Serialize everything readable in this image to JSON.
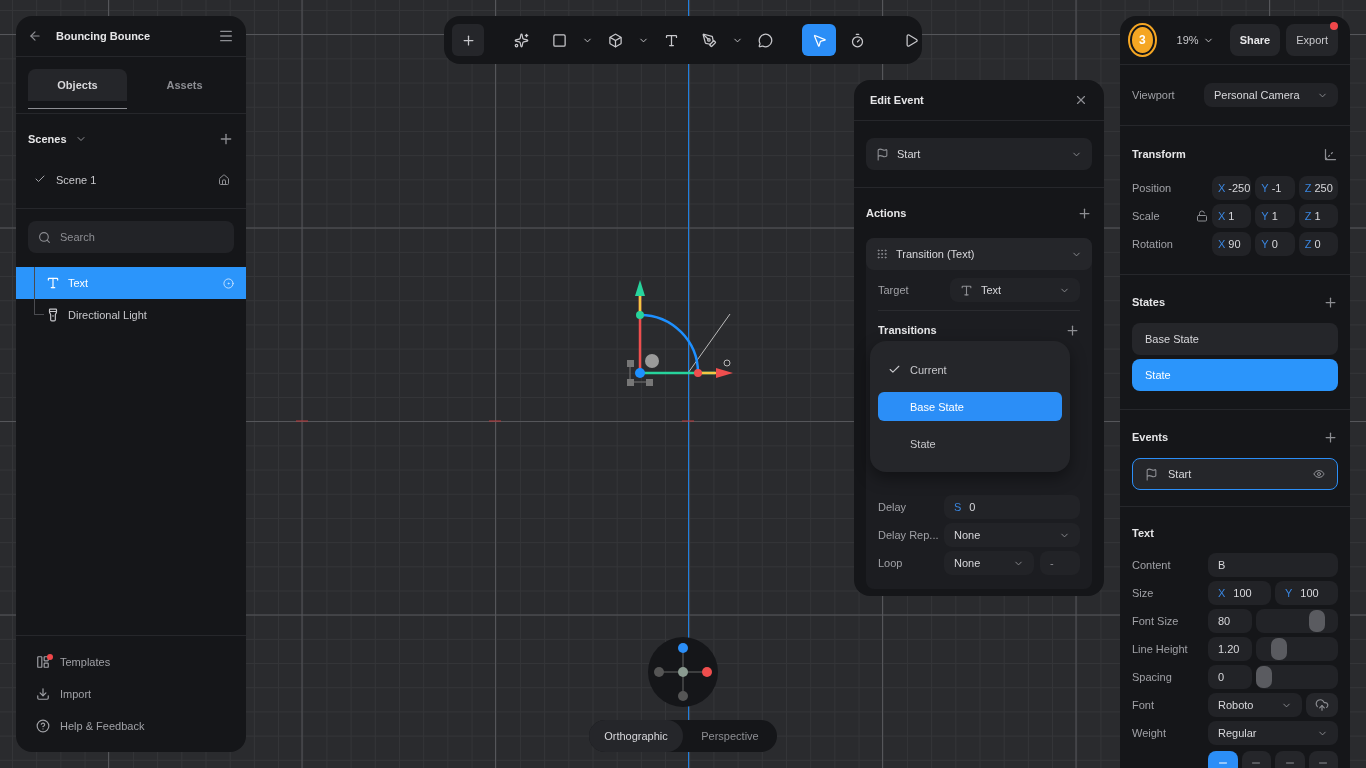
{
  "project": {
    "title": "Bouncing Bounce"
  },
  "left_tabs": [
    {
      "label": "Objects",
      "selected": true
    },
    {
      "label": "Assets",
      "selected": false
    }
  ],
  "scenes": {
    "title": "Scenes",
    "items": [
      {
        "label": "Scene 1",
        "checked": true
      }
    ]
  },
  "search": {
    "placeholder": "Search"
  },
  "layers": [
    {
      "label": "Text",
      "kind": "text",
      "selected": true
    },
    {
      "label": "Directional Light",
      "kind": "light",
      "selected": false
    }
  ],
  "footer_links": [
    {
      "label": "Templates",
      "kind": "templates",
      "badge": true
    },
    {
      "label": "Import",
      "kind": "import",
      "badge": false
    },
    {
      "label": "Help & Feedback",
      "kind": "help",
      "badge": false
    }
  ],
  "toolbar": [
    {
      "tools": [
        {
          "kind": "add",
          "selected": false,
          "dropdown": false
        }
      ]
    },
    {
      "tools": [
        {
          "kind": "ai",
          "selected": false,
          "dropdown": false
        },
        {
          "kind": "shape",
          "selected": false,
          "dropdown": true
        },
        {
          "kind": "cube",
          "selected": false,
          "dropdown": true
        },
        {
          "kind": "text",
          "selected": false,
          "dropdown": false
        },
        {
          "kind": "pen",
          "selected": false,
          "dropdown": true
        },
        {
          "kind": "comment",
          "selected": false,
          "dropdown": false
        }
      ]
    },
    {
      "tools": [
        {
          "kind": "select",
          "selected": true,
          "dropdown": false
        },
        {
          "kind": "timer",
          "selected": false,
          "dropdown": false
        }
      ]
    },
    {
      "tools": [
        {
          "kind": "play",
          "selected": false,
          "dropdown": false
        }
      ]
    }
  ],
  "view_modes": [
    {
      "label": "Orthographic",
      "selected": true
    },
    {
      "label": "Perspective",
      "selected": false
    }
  ],
  "edit_event": {
    "title": "Edit Event",
    "trigger": "Start",
    "actions_title": "Actions",
    "action": "Transition (Text)",
    "target_label": "Target",
    "target": "Text",
    "transitions_title": "Transitions",
    "menu": [
      {
        "label": "Current",
        "checked": true,
        "selected": false
      },
      {
        "label": "Base State",
        "checked": false,
        "selected": true
      },
      {
        "label": "State",
        "checked": false,
        "selected": false
      }
    ],
    "fields": [
      {
        "kind": "prefixed",
        "label": "Delay",
        "prefix": "S",
        "value": "0"
      },
      {
        "kind": "select",
        "label": "Delay Rep...",
        "value": "None"
      },
      {
        "kind": "select_extra",
        "label": "Loop",
        "value": "None",
        "extra": "-"
      }
    ]
  },
  "header": {
    "avatar": "3",
    "zoom": "19%",
    "buttons": [
      {
        "label": "Share",
        "badge": false
      },
      {
        "label": "Export",
        "badge": true
      }
    ]
  },
  "viewport": {
    "label": "Viewport",
    "value": "Personal Camera"
  },
  "transform": {
    "title": "Transform",
    "rows": [
      {
        "label": "Position",
        "lock": false,
        "values": [
          {
            "axis": "X",
            "value": "-250"
          },
          {
            "axis": "Y",
            "value": "-1"
          },
          {
            "axis": "Z",
            "value": "250"
          }
        ]
      },
      {
        "label": "Scale",
        "lock": true,
        "values": [
          {
            "axis": "X",
            "value": "1"
          },
          {
            "axis": "Y",
            "value": "1"
          },
          {
            "axis": "Z",
            "value": "1"
          }
        ]
      },
      {
        "label": "Rotation",
        "lock": false,
        "values": [
          {
            "axis": "X",
            "value": "90"
          },
          {
            "axis": "Y",
            "value": "0"
          },
          {
            "axis": "Z",
            "value": "0"
          }
        ]
      }
    ]
  },
  "states": {
    "title": "States",
    "items": [
      {
        "label": "Base State",
        "selected": false
      },
      {
        "label": "State",
        "selected": true
      }
    ]
  },
  "events": {
    "title": "Events",
    "items": [
      {
        "label": "Start",
        "selected": true
      }
    ]
  },
  "text_props": {
    "title": "Text",
    "content_label": "Content",
    "content": "B",
    "size_label": "Size",
    "size": [
      {
        "axis": "X",
        "value": "100"
      },
      {
        "axis": "Y",
        "value": "100"
      }
    ],
    "sliders": [
      {
        "label": "Font Size",
        "value": "80",
        "level": 0.8
      },
      {
        "label": "Line Height",
        "value": "1.20",
        "level": 0.23
      },
      {
        "label": "Spacing",
        "value": "0",
        "level": 0
      }
    ],
    "font_label": "Font",
    "font": "Roboto",
    "weight_label": "Weight",
    "weight": "Regular",
    "align": [
      {
        "selected": true
      },
      {
        "selected": false
      },
      {
        "selected": false
      },
      {
        "selected": false
      }
    ]
  }
}
